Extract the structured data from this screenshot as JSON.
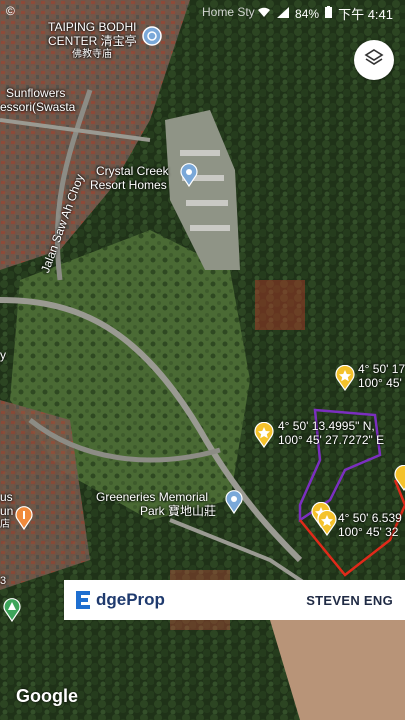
{
  "status_bar": {
    "left_text": "©",
    "app_title": "Home Sty",
    "battery": "84%",
    "time": "下午 4:41",
    "icons": [
      "wifi-icon",
      "signal-icon",
      "battery-icon"
    ]
  },
  "map": {
    "places": [
      {
        "id": "taiping-bodhi",
        "lines": [
          "TAIPING BODHI",
          "CENTER 清宝亭",
          "佛教寺庙"
        ]
      },
      {
        "id": "sunflowers",
        "lines": [
          "Sunflowers",
          "essori(Swasta"
        ]
      },
      {
        "id": "crystal-creek",
        "lines": [
          "Crystal Creek",
          "Resort Homes"
        ]
      },
      {
        "id": "greeneries",
        "lines": [
          "Greeneries Memorial",
          "Park 寶地山莊"
        ]
      },
      {
        "id": "us-un",
        "lines": [
          "us",
          "un",
          "店"
        ]
      }
    ],
    "road_label": "Jalan Saw Ah Choy",
    "partial_labels": [
      "y",
      "3"
    ],
    "coordinates": [
      {
        "lines": [
          "4° 50' 17",
          "100° 45'"
        ]
      },
      {
        "lines": [
          "4° 50' 13.4995\" N,",
          "100° 45' 27.7272\" E"
        ]
      },
      {
        "lines": [
          "4° 50' 6.539",
          "100° 45' 32"
        ]
      }
    ],
    "colors": {
      "boundary_purple": "#7b2fbf",
      "boundary_red": "#e02a1a",
      "pin_yellow": "#f4c22b"
    }
  },
  "controls": {
    "layers_icon": "layers-icon"
  },
  "banner": {
    "brand": "EdgeProp",
    "brand_prefix": "E",
    "brand_rest": "dgeProp",
    "agent": "STEVEN ENG"
  },
  "attribution": "Google"
}
